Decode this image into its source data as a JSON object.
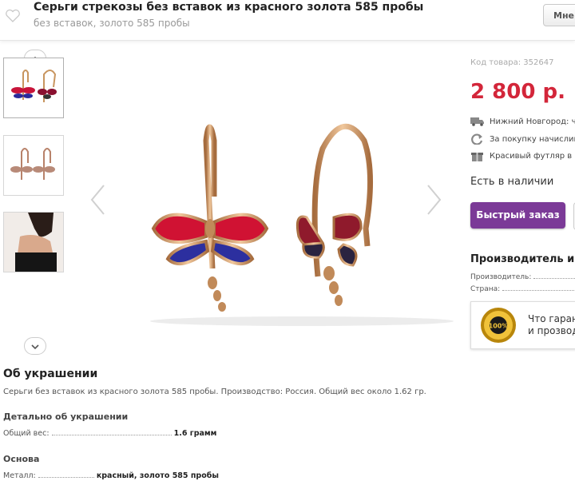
{
  "header": {
    "title": "Серьги стрекозы без вставок из красного золота 585 пробы",
    "subtitle": "без вставок, золото 585 пробы",
    "more_button": "Мне"
  },
  "gallery": {
    "thumbnails": [
      "thumbnail-earrings-pair",
      "thumbnail-earrings-side",
      "thumbnail-model"
    ],
    "up_icon": "chevron-up-icon",
    "down_icon": "chevron-down-icon",
    "prev_icon": "chevron-left-icon",
    "next_icon": "chevron-right-icon"
  },
  "product": {
    "code": "Код товара: 352647",
    "price": "2 800 р.",
    "price_color": "#d3263a",
    "delivery": "Нижний Новгород: че",
    "bonus": "За покупку начислим",
    "gift": "Красивый футляр в",
    "stock": "Есть в наличии",
    "quick_order": "Быстрый заказ",
    "button_color": "#7b3a97"
  },
  "manufacturer": {
    "title": "Производитель и п",
    "maker_label": "Производитель:",
    "country_label": "Страна:",
    "guarantee_line1": "Что гарант",
    "guarantee_line2": "и прозвод",
    "seal_text": "100%"
  },
  "about": {
    "title": "Об украшении",
    "description": "Серьги без вставок из красного золота 585 пробы. Производство: Россия. Общий вес около 1.62 гр.",
    "details_title": "Детально об украшении",
    "weight_label": "Общий вес:",
    "weight_value": "1.6 грамм",
    "base_title": "Основа",
    "metal_label": "Металл:",
    "metal_value": "красный, золото 585 пробы"
  }
}
